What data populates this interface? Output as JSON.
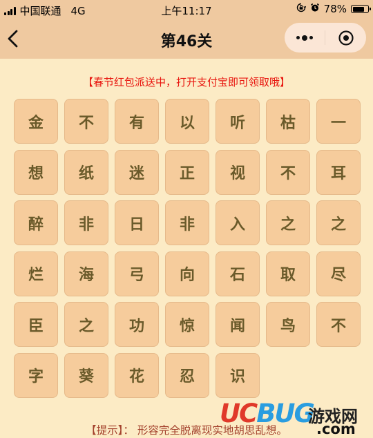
{
  "status_bar": {
    "carrier": "中国联通",
    "network": "4G",
    "time": "上午11:17",
    "battery_percent_label": "78%",
    "battery_level": 0.78,
    "icons": [
      "signal-icon",
      "orientation-lock-icon",
      "alarm-icon",
      "battery-icon"
    ]
  },
  "nav": {
    "title": "第46关",
    "back_icon": "chevron-left-icon",
    "more_icon": "more-dots-icon",
    "close_icon": "target-circle-icon"
  },
  "notice": "【春节红包派送中，打开支付宝即可领取哦】",
  "grid": {
    "tiles": [
      "金",
      "不",
      "有",
      "以",
      "听",
      "枯",
      "一",
      "想",
      "纸",
      "迷",
      "正",
      "视",
      "不",
      "耳",
      "醉",
      "非",
      "日",
      "非",
      "入",
      "之",
      "之",
      "烂",
      "海",
      "弓",
      "向",
      "石",
      "取",
      "尽",
      "臣",
      "之",
      "功",
      "惊",
      "闻",
      "鸟",
      "不",
      "字",
      "葵",
      "花",
      "忍",
      "识"
    ]
  },
  "hint": "【提示】： 形容完全脱离现实地胡思乱想。",
  "watermark": {
    "brand_uc": "UC",
    "brand_bug": "BUG",
    "site": "游戏网",
    "domain": ".com"
  },
  "colors": {
    "header_bg": "#efc9a0",
    "page_bg": "#fcebc5",
    "tile_bg": "#f6cc9c",
    "tile_text": "#6a5a2a",
    "notice_red": "#e8160f",
    "hint_text": "#a3402c"
  }
}
